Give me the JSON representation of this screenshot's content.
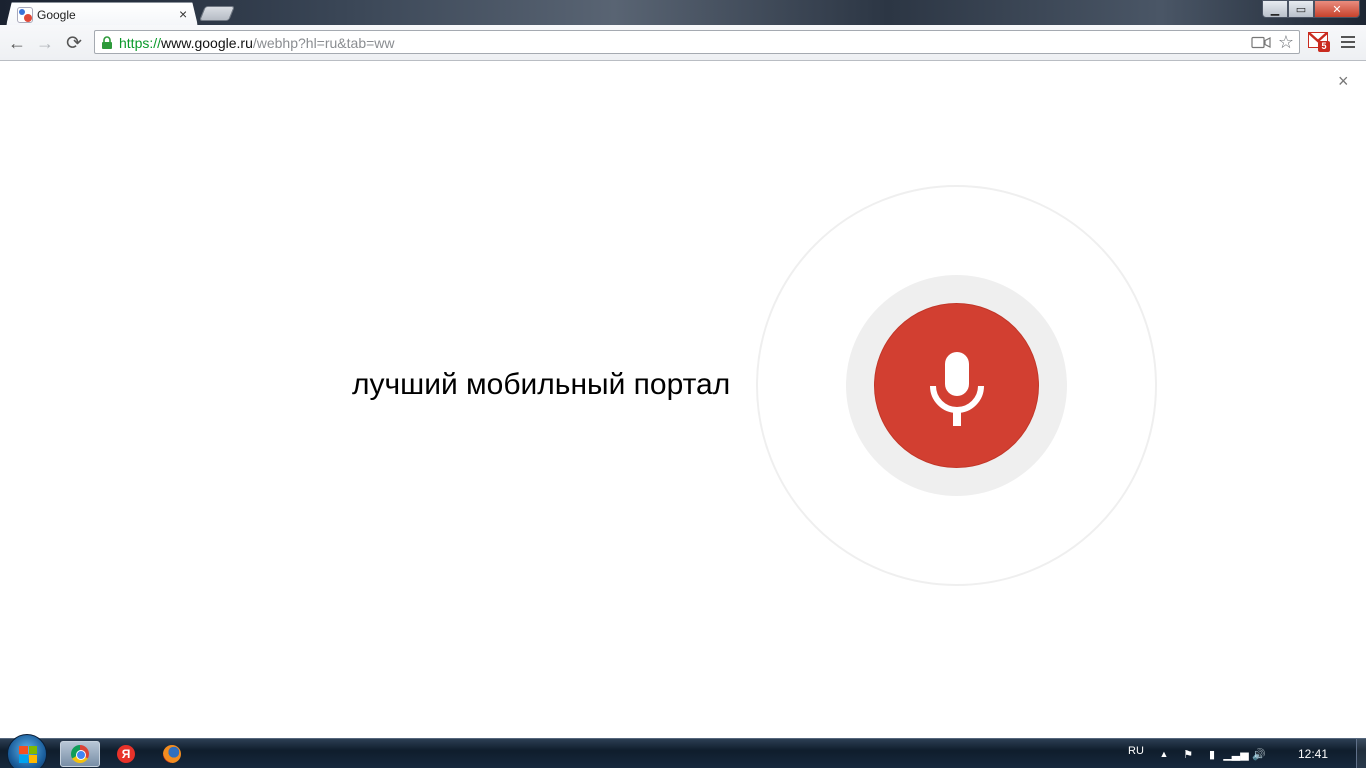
{
  "browser": {
    "tab": {
      "title": "Google",
      "close_glyph": "×"
    },
    "url": {
      "scheme": "https://",
      "host": "www.google.ru",
      "path": "/webhp?hl=ru&tab=ww"
    },
    "nav": {
      "back_glyph": "←",
      "forward_glyph": "→",
      "reload_glyph": "⟳"
    },
    "star_glyph": "☆",
    "gmail_badge_count": "5",
    "window_controls": {
      "minimize_glyph": "▁",
      "maximize_glyph": "▭",
      "close_glyph": "✕"
    }
  },
  "page": {
    "overlay_close_glyph": "×",
    "voice_transcript": "лучший мобильный портал",
    "mic_color": "#d23f31",
    "ring_color": "#efefef"
  },
  "taskbar": {
    "apps": [
      {
        "name": "chrome",
        "active": true
      },
      {
        "name": "yandex"
      },
      {
        "name": "firefox"
      }
    ],
    "yandex_glyph": "Я",
    "tray": {
      "language": "RU",
      "arrow_glyph": "▲",
      "flag_glyph": "⚑",
      "power_glyph": "▮",
      "signal_glyph": "▁▃▅",
      "volume_glyph": "🔊",
      "clock": "12:41"
    }
  }
}
